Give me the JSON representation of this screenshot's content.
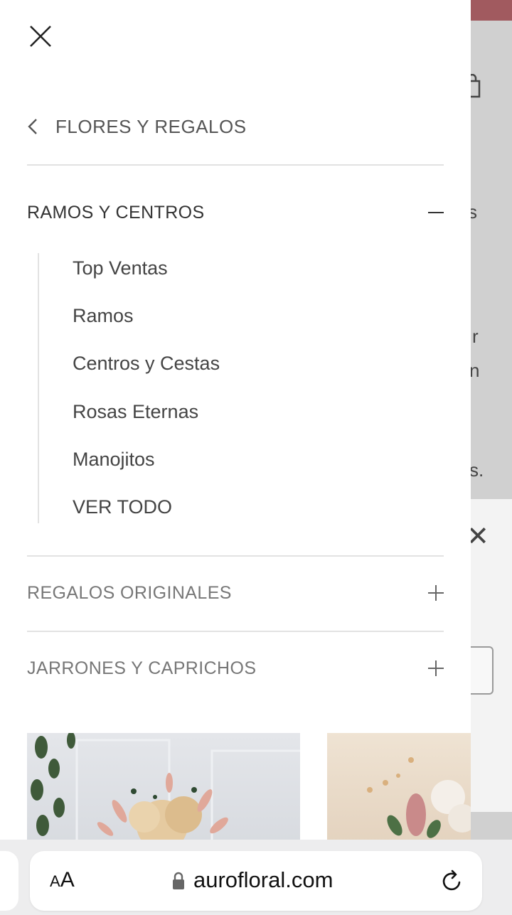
{
  "drawer": {
    "back_label": "FLORES Y REGALOS",
    "sections": [
      {
        "title": "RAMOS Y CENTROS",
        "expanded": true
      },
      {
        "title": "REGALOS ORIGINALES",
        "expanded": false
      },
      {
        "title": "JARRONES Y CAPRICHOS",
        "expanded": false
      }
    ],
    "sub_items": [
      "Top Ventas",
      "Ramos",
      "Centros y Cestas",
      "Rosas Eternas",
      "Manojitos",
      "VER TODO"
    ]
  },
  "background_fragments": [
    "s",
    "r",
    "n",
    "s."
  ],
  "browser": {
    "aa_label_small": "A",
    "aa_label_large": "A",
    "url": "aurofloral.com"
  },
  "colors": {
    "accent": "#a15a5f",
    "overlay": "#d0d0d0",
    "text_dark": "#333333",
    "text_gray": "#777777"
  },
  "icons": [
    "close-icon",
    "chevron-left-icon",
    "minus-icon",
    "plus-icon",
    "lock-icon",
    "reload-icon",
    "shopping-bag-icon"
  ]
}
